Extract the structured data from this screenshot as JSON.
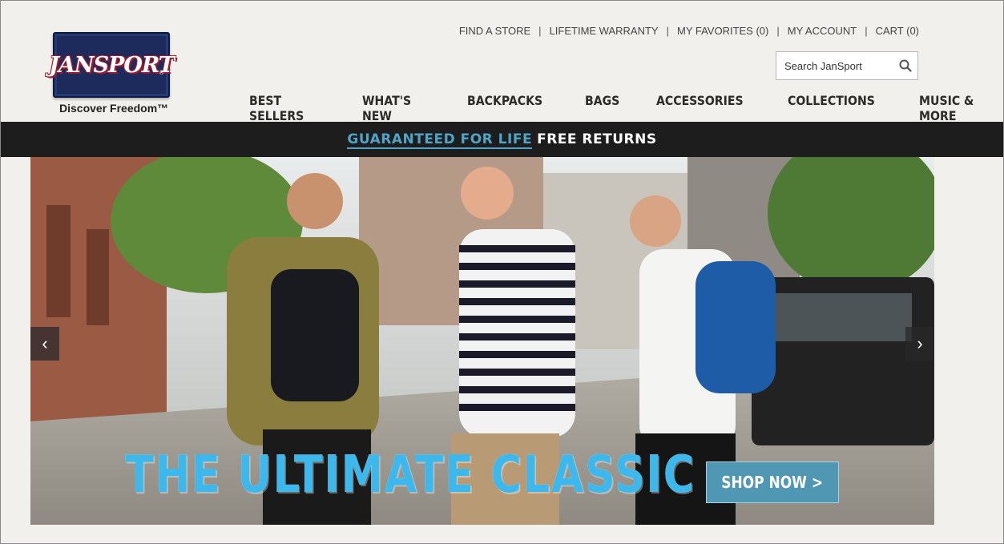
{
  "brand": {
    "logo_text": "JANSPORT",
    "tagline": "Discover Freedom™"
  },
  "utility_nav": [
    {
      "label": "FIND A STORE"
    },
    {
      "label": "LIFETIME WARRANTY"
    },
    {
      "label": "MY FAVORITES (0)"
    },
    {
      "label": "MY ACCOUNT"
    },
    {
      "label": "CART (0)"
    }
  ],
  "search": {
    "placeholder": "Search JanSport",
    "icon": "search-icon"
  },
  "main_nav": [
    {
      "label": "BEST SELLERS"
    },
    {
      "label": "WHAT'S NEW"
    },
    {
      "label": "BACKPACKS"
    },
    {
      "label": "BAGS"
    },
    {
      "label": "ACCESSORIES"
    },
    {
      "label": "COLLECTIONS"
    },
    {
      "label": "MUSIC & MORE"
    }
  ],
  "promo": {
    "link_text": "GUARANTEED FOR LIFE",
    "text": "FREE RETURNS",
    "link_color": "#4fa4c8"
  },
  "hero": {
    "headline": "THE ULTIMATE CLASSIC",
    "cta_label": "SHOP NOW >",
    "prev_icon": "chevron-left-icon",
    "next_icon": "chevron-right-icon",
    "prev_glyph": "‹",
    "next_glyph": "›",
    "headline_color": "#3db8ec",
    "cta_color": "#4f97b3"
  }
}
